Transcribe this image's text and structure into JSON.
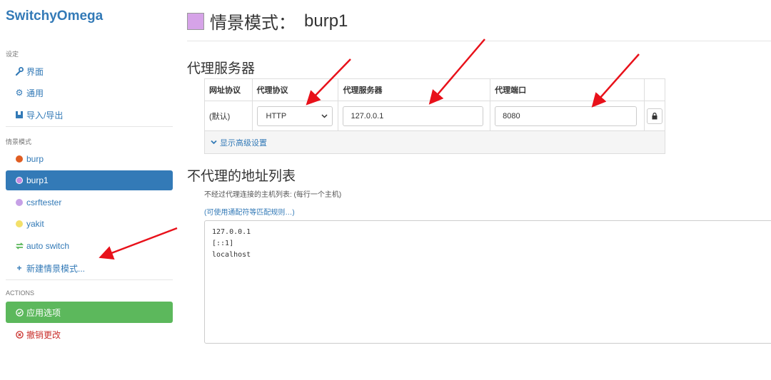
{
  "app": {
    "brand": "SwitchyOmega"
  },
  "sidebar": {
    "settings_header": "设定",
    "settings_items": [
      {
        "icon": "wrench-icon",
        "label": "界面"
      },
      {
        "icon": "gear-icon",
        "label": "通用"
      },
      {
        "icon": "import-export-icon",
        "label": "导入/导出"
      }
    ],
    "profiles_header": "情景模式",
    "profiles": [
      {
        "label": "burp",
        "color": "#e05d22"
      },
      {
        "label": "burp1",
        "color": "#c58be0"
      },
      {
        "label": "csrftester",
        "color": "#c6a0e6"
      },
      {
        "label": "yakit",
        "color": "#f3e06a"
      },
      {
        "label": "auto switch",
        "color": "#5cb85c"
      }
    ],
    "new_profile": "新建情景模式...",
    "actions_header": "ACTIONS",
    "apply": "应用选项",
    "discard": "撤销更改"
  },
  "header": {
    "title_prefix": "情景模式：",
    "profile_name": "burp1",
    "swatch_color": "#d6a3e8"
  },
  "proxy_section": {
    "heading": "代理服务器",
    "columns": [
      "网址协议",
      "代理协议",
      "代理服务器",
      "代理端口"
    ],
    "row": {
      "scheme": "(默认)",
      "protocol": "HTTP",
      "server": "127.0.0.1",
      "port": "8080"
    },
    "advanced": "显示高级设置"
  },
  "bypass_section": {
    "heading": "不代理的地址列表",
    "help": "不经过代理连接的主机列表: (每行一个主机)",
    "link": "(可使用通配符等匹配规则…)",
    "entries": [
      "127.0.0.1",
      "[::1]",
      "localhost"
    ]
  }
}
